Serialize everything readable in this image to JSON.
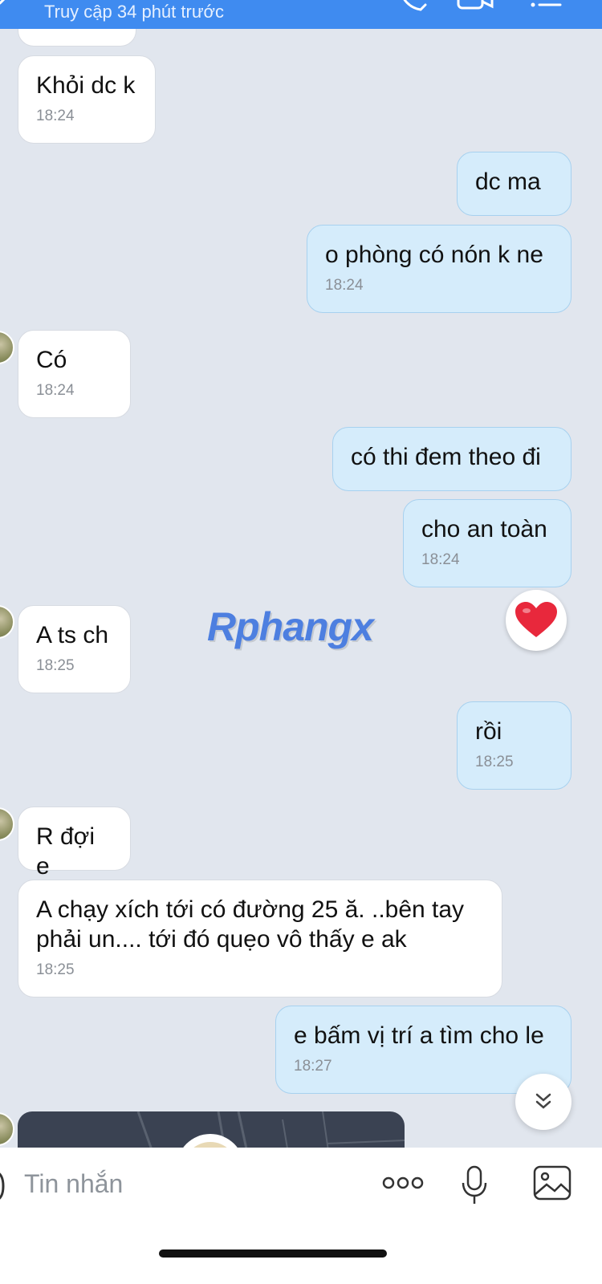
{
  "header": {
    "subtitle": "Truy cập 34 phút trước"
  },
  "messages": [
    {
      "side": "in",
      "text": "Khỏi dc k",
      "time": "18:24"
    },
    {
      "side": "out",
      "text": "dc ma",
      "time": ""
    },
    {
      "side": "out",
      "text": "o phòng có nón k ne",
      "time": "18:24"
    },
    {
      "side": "in",
      "text": "Có",
      "time": "18:24"
    },
    {
      "side": "out",
      "text": "có thi đem theo đi",
      "time": ""
    },
    {
      "side": "out",
      "text": "cho an toàn",
      "time": "18:24"
    },
    {
      "side": "in",
      "text": "A ts ch",
      "time": "18:25"
    },
    {
      "side": "out",
      "text": "rồi",
      "time": "18:25"
    },
    {
      "side": "in",
      "text": "R đợi e",
      "time": ""
    },
    {
      "side": "in",
      "text": "A chạy xích tới có đường 25 ă. ..bên tay phải un.... tới đó quẹo vô thấy e ak",
      "time": "18:25"
    },
    {
      "side": "out",
      "text": "e bấm vị trí a tìm cho le",
      "time": "18:27"
    }
  ],
  "reaction": {
    "icon": "heart-icon",
    "color": "#e8283c"
  },
  "watermark": "Rphangx",
  "input": {
    "placeholder": "Tin nhắn"
  },
  "icons": {
    "more": "more-dots-icon",
    "mic": "microphone-icon",
    "image": "image-icon",
    "scroll": "chevron-double-down-icon"
  },
  "colors": {
    "header": "#3f8bf0",
    "background": "#e1e6ee",
    "outgoing": "#d5ecfb",
    "incoming": "#ffffff"
  }
}
